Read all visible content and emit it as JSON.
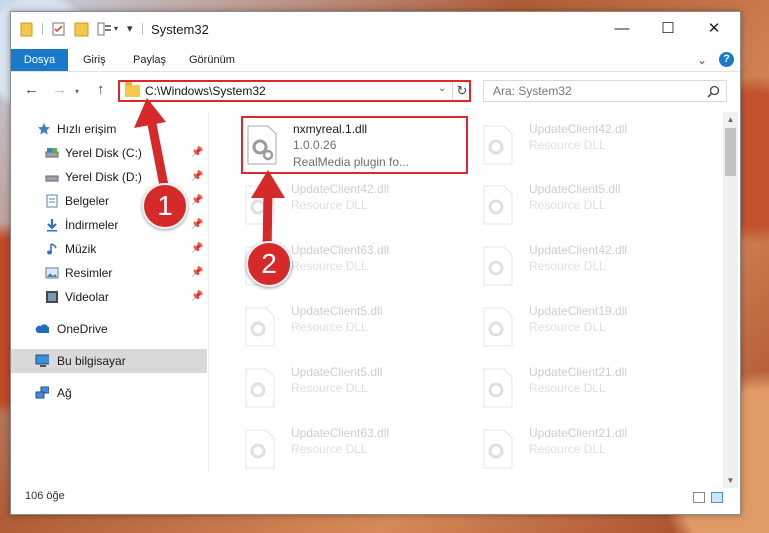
{
  "window": {
    "title": "System32",
    "controls": {
      "minimize": "—",
      "maximize": "☐",
      "close": "✕"
    }
  },
  "ribbon": {
    "file_tab": "Dosya",
    "tabs": [
      "Giriş",
      "Paylaş",
      "Görünüm"
    ],
    "help": "?"
  },
  "address": {
    "path": "C:\\Windows\\System32"
  },
  "search": {
    "placeholder": "Ara: System32"
  },
  "sidebar": {
    "quick_access": "Hızlı erişim",
    "items": [
      {
        "label": "Yerel Disk (C:)",
        "icon": "drive-icon"
      },
      {
        "label": "Yerel Disk (D:)",
        "icon": "drive-icon"
      },
      {
        "label": "Belgeler",
        "icon": "documents-icon"
      },
      {
        "label": "İndirmeler",
        "icon": "downloads-icon"
      },
      {
        "label": "Müzik",
        "icon": "music-icon"
      },
      {
        "label": "Resimler",
        "icon": "pictures-icon"
      },
      {
        "label": "Videolar",
        "icon": "videos-icon"
      }
    ],
    "onedrive": "OneDrive",
    "this_pc": "Bu bilgisayar",
    "network": "Ağ"
  },
  "files": {
    "highlighted": {
      "name": "nxmyreal.1.dll",
      "version": "1.0.0.26",
      "description": "RealMedia plugin fo..."
    },
    "right_col": [
      {
        "name": "UpdateClient42.dll",
        "type": "Resource DLL"
      },
      {
        "name": "UpdateClient5.dll",
        "type": "Resource DLL"
      },
      {
        "name": "UpdateClient42.dll",
        "type": "Resource DLL"
      },
      {
        "name": "UpdateClient19.dll",
        "type": "Resource DLL"
      },
      {
        "name": "UpdateClient21.dll",
        "type": "Resource DLL"
      },
      {
        "name": "UpdateClient21.dll",
        "type": "Resource DLL"
      }
    ],
    "left_col": [
      {
        "name": "UpdateClient42.dll",
        "type": "Resource DLL"
      },
      {
        "name": "UpdateClient63.dll",
        "type": "Resource DLL"
      },
      {
        "name": "UpdateClient5.dll",
        "type": "Resource DLL"
      },
      {
        "name": "UpdateClient5.dll",
        "type": "Resource DLL"
      },
      {
        "name": "UpdateClient63.dll",
        "type": "Resource DLL"
      }
    ]
  },
  "status": {
    "count": "106 öğe"
  },
  "annotations": {
    "step1": "1",
    "step2": "2",
    "color": "#d62a2a"
  }
}
